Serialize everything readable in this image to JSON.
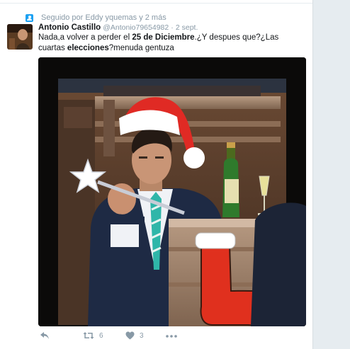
{
  "context": {
    "text": "Seguido por Eddy yquemas y 2 más"
  },
  "tweet": {
    "name": "Antonio Castillo",
    "handle": "@Antonio79654982",
    "separator": "·",
    "time": "2 sept.",
    "text": {
      "p1": "Nada,a volver a perder el ",
      "b1": "25 de Diciembre",
      "p2": ".¿Y despues que?¿Las cuartas ",
      "b2": "elecciones",
      "p3": "?menuda gentuza"
    }
  },
  "actions": {
    "retweets": "6",
    "likes": "3"
  },
  "colors": {
    "accent": "#1da1f2",
    "muted": "#8899a6",
    "background": "#e6ecf0"
  },
  "icons": [
    "person-icon",
    "reply-icon",
    "retweet-icon",
    "heart-icon",
    "more-icon"
  ]
}
